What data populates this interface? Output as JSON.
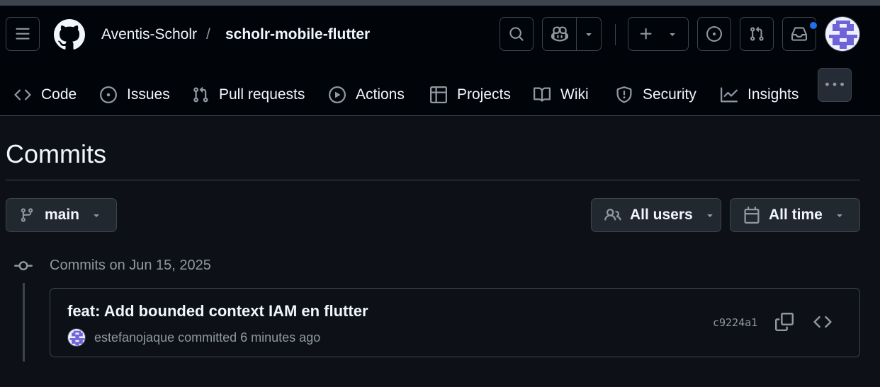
{
  "colors": {
    "header_bg": "#010409",
    "page_bg": "#0d1117",
    "border": "#3d444d",
    "text": "#f0f6fc",
    "muted": "#9198a1",
    "notification": "#1f6feb"
  },
  "header": {
    "owner": "Aventis-Scholr",
    "separator": "/",
    "repo": "scholr-mobile-flutter",
    "icons": [
      "menu-icon",
      "github-logo-icon",
      "search-icon",
      "copilot-icon",
      "triangle-down-icon",
      "plus-icon",
      "issue-opened-icon",
      "git-pull-request-icon",
      "inbox-icon",
      "avatar"
    ]
  },
  "repo_nav": {
    "tabs": [
      {
        "label": "Code",
        "icon": "code-icon"
      },
      {
        "label": "Issues",
        "icon": "issue-opened-icon"
      },
      {
        "label": "Pull requests",
        "icon": "git-pull-request-icon"
      },
      {
        "label": "Actions",
        "icon": "play-icon"
      },
      {
        "label": "Projects",
        "icon": "table-icon"
      },
      {
        "label": "Wiki",
        "icon": "book-icon"
      },
      {
        "label": "Security",
        "icon": "shield-icon"
      },
      {
        "label": "Insights",
        "icon": "graph-icon"
      }
    ],
    "more_icon": "kebab-horizontal-icon"
  },
  "page": {
    "title": "Commits"
  },
  "filters": {
    "branch": "main",
    "users": "All users",
    "time": "All time"
  },
  "timeline": {
    "heading": "Commits on Jun 15, 2025",
    "commits": [
      {
        "message": "feat: Add bounded context IAM en flutter",
        "author": "estefanojaque",
        "meta": "committed 6 minutes ago",
        "sha": "c9224a1"
      }
    ]
  }
}
